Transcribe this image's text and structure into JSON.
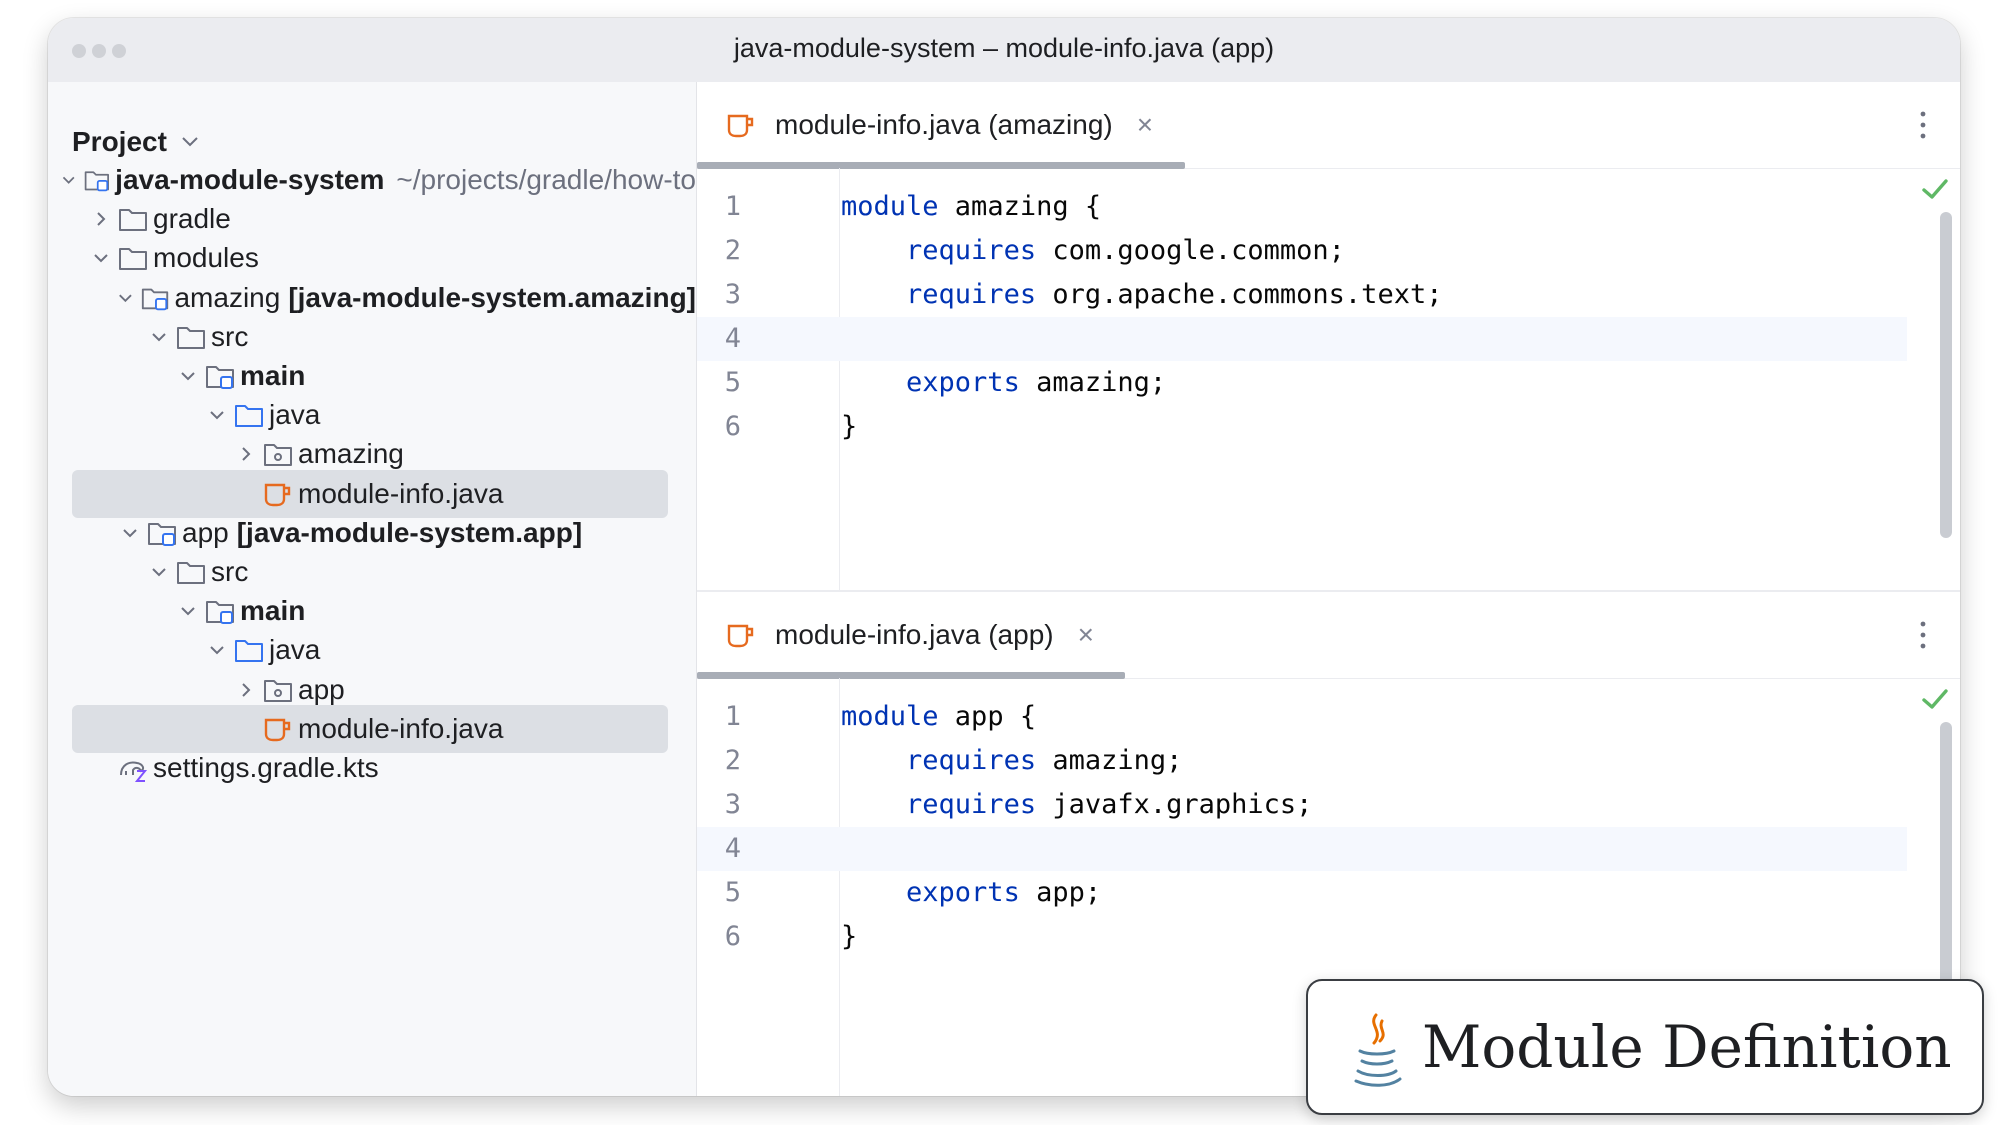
{
  "window": {
    "title": "java-module-system – module-info.java (app)"
  },
  "sidebar": {
    "header": "Project",
    "tree": [
      {
        "label": "java-module-system",
        "bold": true,
        "meta": "~/projects/gradle/how-to",
        "depth": 0,
        "chevron": "down",
        "icon": "module-folder-icon"
      },
      {
        "label": "gradle",
        "bold": false,
        "meta": "",
        "depth": 1,
        "chevron": "right",
        "icon": "folder-icon"
      },
      {
        "label": "modules",
        "bold": false,
        "meta": "",
        "depth": 1,
        "chevron": "down",
        "icon": "folder-icon"
      },
      {
        "label": "amazing",
        "bold": false,
        "suffix": "[java-module-system.amazing]",
        "meta": "",
        "depth": 2,
        "chevron": "down",
        "icon": "module-folder-icon"
      },
      {
        "label": "src",
        "bold": false,
        "meta": "",
        "depth": 3,
        "chevron": "down",
        "icon": "folder-icon"
      },
      {
        "label": "main",
        "bold": true,
        "meta": "",
        "depth": 4,
        "chevron": "down",
        "icon": "module-folder-icon"
      },
      {
        "label": "java",
        "bold": false,
        "meta": "",
        "depth": 5,
        "chevron": "down",
        "icon": "source-folder-icon"
      },
      {
        "label": "amazing",
        "bold": false,
        "meta": "",
        "depth": 6,
        "chevron": "right",
        "icon": "package-icon"
      },
      {
        "label": "module-info.java",
        "bold": false,
        "meta": "",
        "depth": 6,
        "chevron": "none",
        "icon": "java-file-icon",
        "selected": true
      },
      {
        "label": "app",
        "bold": false,
        "suffix": "[java-module-system.app]",
        "meta": "",
        "depth": 2,
        "chevron": "down",
        "icon": "module-folder-icon"
      },
      {
        "label": "src",
        "bold": false,
        "meta": "",
        "depth": 3,
        "chevron": "down",
        "icon": "folder-icon"
      },
      {
        "label": "main",
        "bold": true,
        "meta": "",
        "depth": 4,
        "chevron": "down",
        "icon": "module-folder-icon"
      },
      {
        "label": "java",
        "bold": false,
        "meta": "",
        "depth": 5,
        "chevron": "down",
        "icon": "source-folder-icon"
      },
      {
        "label": "app",
        "bold": false,
        "meta": "",
        "depth": 6,
        "chevron": "right",
        "icon": "package-icon"
      },
      {
        "label": "module-info.java",
        "bold": false,
        "meta": "",
        "depth": 6,
        "chevron": "none",
        "icon": "java-file-icon",
        "selected": true
      },
      {
        "label": "settings.gradle.kts",
        "bold": false,
        "meta": "",
        "depth": 1,
        "chevron": "none",
        "icon": "gradle-kts-icon"
      }
    ]
  },
  "editors": [
    {
      "tab_label": "module-info.java (amazing)",
      "close_glyph": "×",
      "current_line": 4,
      "lines": [
        {
          "n": "1",
          "parts": [
            {
              "t": "module",
              "kw": true
            },
            {
              "t": " amazing {"
            }
          ]
        },
        {
          "n": "2",
          "parts": [
            {
              "t": "    "
            },
            {
              "t": "requires",
              "kw": true
            },
            {
              "t": " com.google.common;"
            }
          ]
        },
        {
          "n": "3",
          "parts": [
            {
              "t": "    "
            },
            {
              "t": "requires",
              "kw": true
            },
            {
              "t": " org.apache.commons.text;"
            }
          ]
        },
        {
          "n": "4",
          "parts": []
        },
        {
          "n": "5",
          "parts": [
            {
              "t": "    "
            },
            {
              "t": "exports",
              "kw": true
            },
            {
              "t": " amazing;"
            }
          ]
        },
        {
          "n": "6",
          "parts": [
            {
              "t": "}"
            }
          ]
        }
      ]
    },
    {
      "tab_label": "module-info.java (app)",
      "close_glyph": "×",
      "current_line": 4,
      "lines": [
        {
          "n": "1",
          "parts": [
            {
              "t": "module",
              "kw": true
            },
            {
              "t": " app {"
            }
          ]
        },
        {
          "n": "2",
          "parts": [
            {
              "t": "    "
            },
            {
              "t": "requires",
              "kw": true
            },
            {
              "t": " amazing;"
            }
          ]
        },
        {
          "n": "3",
          "parts": [
            {
              "t": "    "
            },
            {
              "t": "requires",
              "kw": true
            },
            {
              "t": " javafx.graphics;"
            }
          ]
        },
        {
          "n": "4",
          "parts": []
        },
        {
          "n": "5",
          "parts": [
            {
              "t": "    "
            },
            {
              "t": "exports",
              "kw": true
            },
            {
              "t": " app;"
            }
          ]
        },
        {
          "n": "6",
          "parts": [
            {
              "t": "}"
            }
          ]
        }
      ]
    }
  ],
  "badge": {
    "text": "Module Definition",
    "icon": "java-logo-icon"
  },
  "colors": {
    "keyword": "#0033b3",
    "java_icon": "#e66a1f",
    "module_icon": "#3574f0",
    "check": "#5fb865"
  }
}
